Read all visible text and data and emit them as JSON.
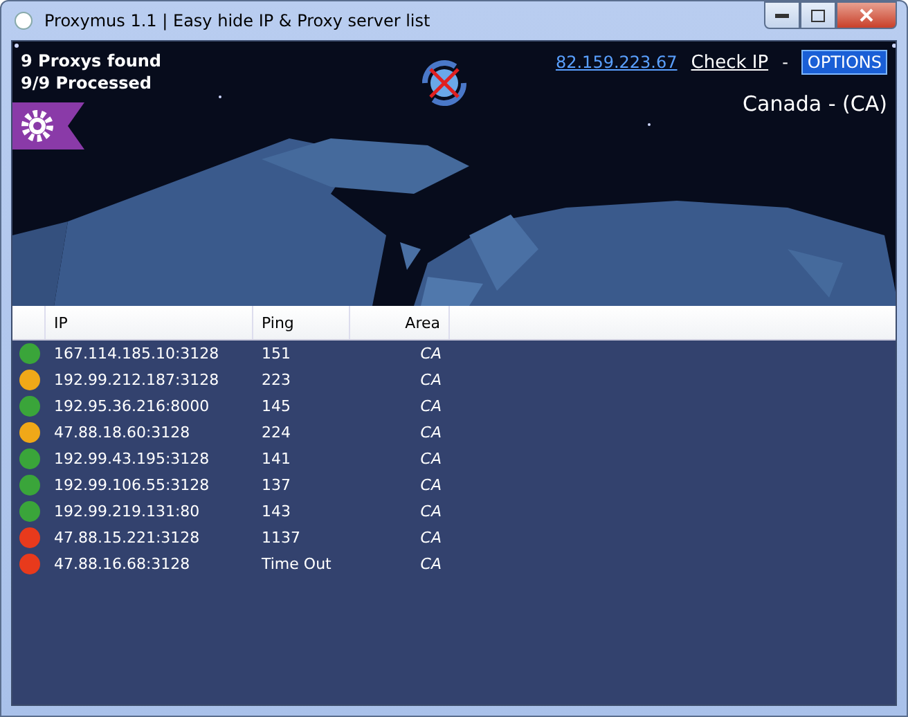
{
  "window": {
    "title": "Proxymus 1.1 | Easy hide IP & Proxy server list"
  },
  "header": {
    "found": "9 Proxys found",
    "processed": "9/9 Processed",
    "ip_link": "82.159.223.67",
    "check_ip": "Check IP",
    "separator": "-",
    "options": "OPTIONS",
    "country": "Canada - (CA)"
  },
  "table": {
    "columns": [
      "IP",
      "Ping",
      "Area"
    ],
    "rows": [
      {
        "color": "#3aa53a",
        "ip": "167.114.185.10:3128",
        "ping": "151",
        "area": "CA"
      },
      {
        "color": "#f0a818",
        "ip": "192.99.212.187:3128",
        "ping": "223",
        "area": "CA"
      },
      {
        "color": "#3aa53a",
        "ip": "192.95.36.216:8000",
        "ping": "145",
        "area": "CA"
      },
      {
        "color": "#f0a818",
        "ip": "47.88.18.60:3128",
        "ping": "224",
        "area": "CA"
      },
      {
        "color": "#3aa53a",
        "ip": "192.99.43.195:3128",
        "ping": "141",
        "area": "CA"
      },
      {
        "color": "#3aa53a",
        "ip": "192.99.106.55:3128",
        "ping": "137",
        "area": "CA"
      },
      {
        "color": "#3aa53a",
        "ip": "192.99.219.131:80",
        "ping": "143",
        "area": "CA"
      },
      {
        "color": "#e83a1c",
        "ip": "47.88.15.221:3128",
        "ping": "1137",
        "area": "CA"
      },
      {
        "color": "#e83a1c",
        "ip": "47.88.16.68:3128",
        "ping": "Time Out",
        "area": "CA"
      }
    ]
  }
}
